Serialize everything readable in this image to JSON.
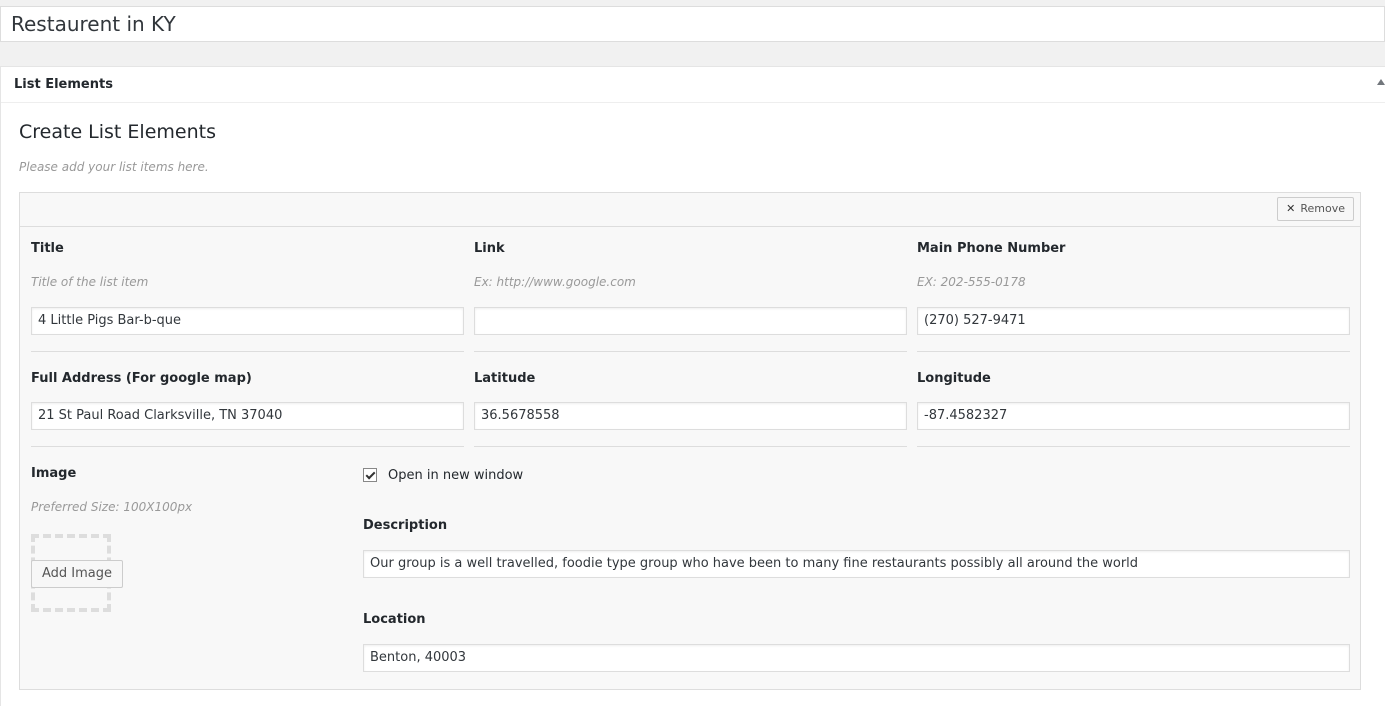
{
  "post_title": "Restaurent in KY",
  "metabox": {
    "title": "List Elements",
    "section_title": "Create List Elements",
    "section_desc": "Please add your list items here."
  },
  "item": {
    "remove_label": "Remove",
    "title": {
      "label": "Title",
      "hint": "Title of the list item",
      "value": "4 Little Pigs Bar-b-que"
    },
    "link": {
      "label": "Link",
      "hint": "Ex: http://www.google.com",
      "value": ""
    },
    "phone": {
      "label": "Main Phone Number",
      "hint": "EX: 202-555-0178",
      "value": "(270) 527-9471"
    },
    "address": {
      "label": "Full Address (For google map)",
      "value": "21 St Paul Road  Clarksville, TN 37040"
    },
    "latitude": {
      "label": "Latitude",
      "value": "36.5678558"
    },
    "longitude": {
      "label": "Longitude",
      "value": "-87.4582327"
    },
    "image": {
      "label": "Image",
      "hint": "Preferred Size: 100X100px",
      "button_label": "Add Image"
    },
    "new_window": {
      "label": "Open in new window",
      "checked": true
    },
    "description": {
      "label": "Description",
      "value": "Our group is a well travelled, foodie type group who have been to many fine restaurants possibly all around the world"
    },
    "location": {
      "label": "Location",
      "value": "Benton, 40003"
    }
  }
}
